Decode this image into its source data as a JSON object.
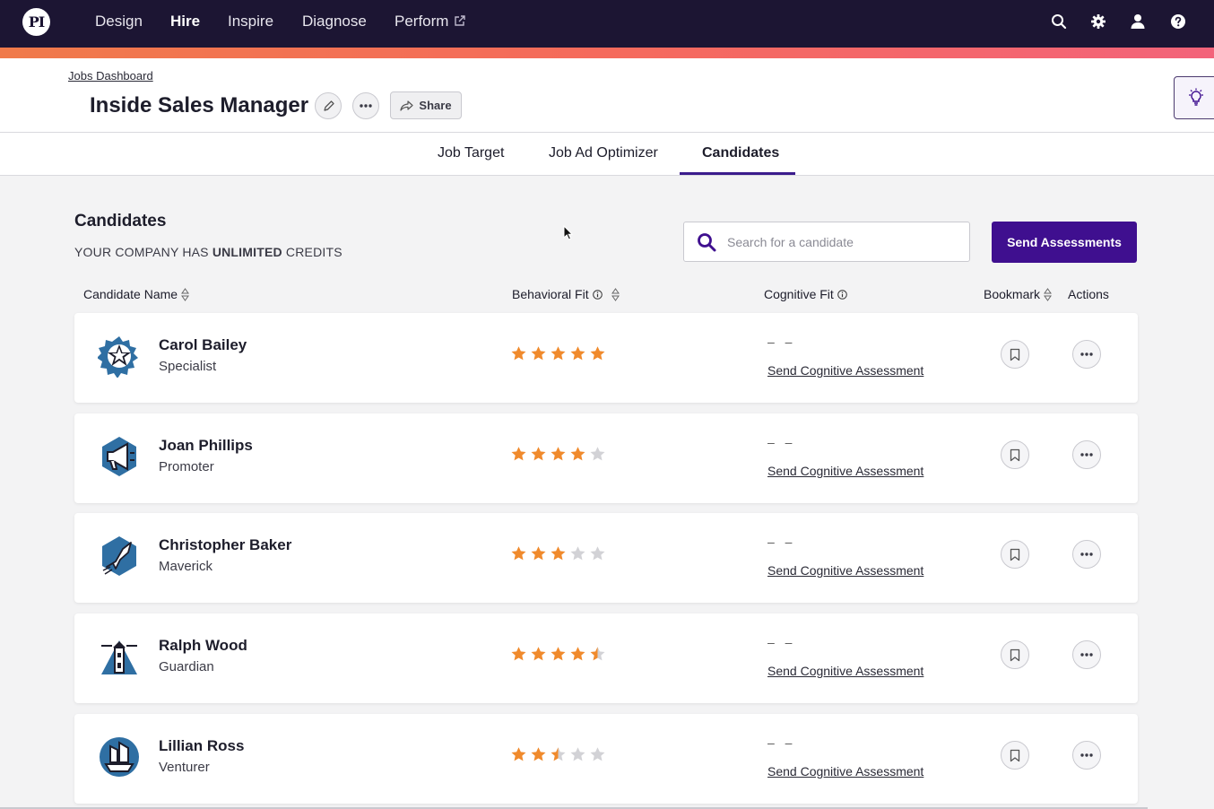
{
  "topnav": {
    "logo": "PI",
    "items": [
      {
        "label": "Design"
      },
      {
        "label": "Hire"
      },
      {
        "label": "Inspire"
      },
      {
        "label": "Diagnose"
      },
      {
        "label": "Perform"
      }
    ],
    "active": "Hire",
    "icons": [
      "search-icon",
      "gear-icon",
      "user-icon",
      "help-icon"
    ]
  },
  "header": {
    "breadcrumb": "Jobs Dashboard",
    "title": "Inside Sales Manager",
    "share_label": "Share"
  },
  "tabs": [
    {
      "label": "Job Target"
    },
    {
      "label": "Job Ad Optimizer"
    },
    {
      "label": "Candidates"
    }
  ],
  "active_tab": "Candidates",
  "section": {
    "title": "Candidates",
    "credits_prefix": "YOUR COMPANY HAS ",
    "credits_bold": "UNLIMITED",
    "credits_suffix": " CREDITS",
    "search_placeholder": "Search for a candidate",
    "send_button": "Send Assessments"
  },
  "columns": {
    "name": "Candidate Name",
    "behavioral": "Behavioral Fit",
    "cognitive": "Cognitive Fit",
    "bookmark": "Bookmark",
    "actions": "Actions"
  },
  "candidates": [
    {
      "name": "Carol Bailey",
      "profile": "Specialist",
      "icon": "specialist-icon",
      "rating": 5,
      "cognitive": "– –",
      "cognitive_link": "Send Cognitive Assessment"
    },
    {
      "name": "Joan Phillips",
      "profile": "Promoter",
      "icon": "promoter-icon",
      "rating": 4,
      "cognitive": "– –",
      "cognitive_link": "Send Cognitive Assessment"
    },
    {
      "name": "Christopher Baker",
      "profile": "Maverick",
      "icon": "maverick-icon",
      "rating": 3,
      "cognitive": "– –",
      "cognitive_link": "Send Cognitive Assessment"
    },
    {
      "name": "Ralph Wood",
      "profile": "Guardian",
      "icon": "guardian-icon",
      "rating": 4.5,
      "cognitive": "– –",
      "cognitive_link": "Send Cognitive Assessment"
    },
    {
      "name": "Lillian Ross",
      "profile": "Venturer",
      "icon": "venturer-icon",
      "rating": 2.5,
      "cognitive": "– –",
      "cognitive_link": "Send Cognitive Assessment"
    }
  ],
  "colors": {
    "nav_bg": "#1c1533",
    "accent": "#3f0f8f",
    "star_filled": "#f08a2c",
    "star_empty": "#d2d2d6",
    "avatar_blue": "#2f6fa3"
  }
}
